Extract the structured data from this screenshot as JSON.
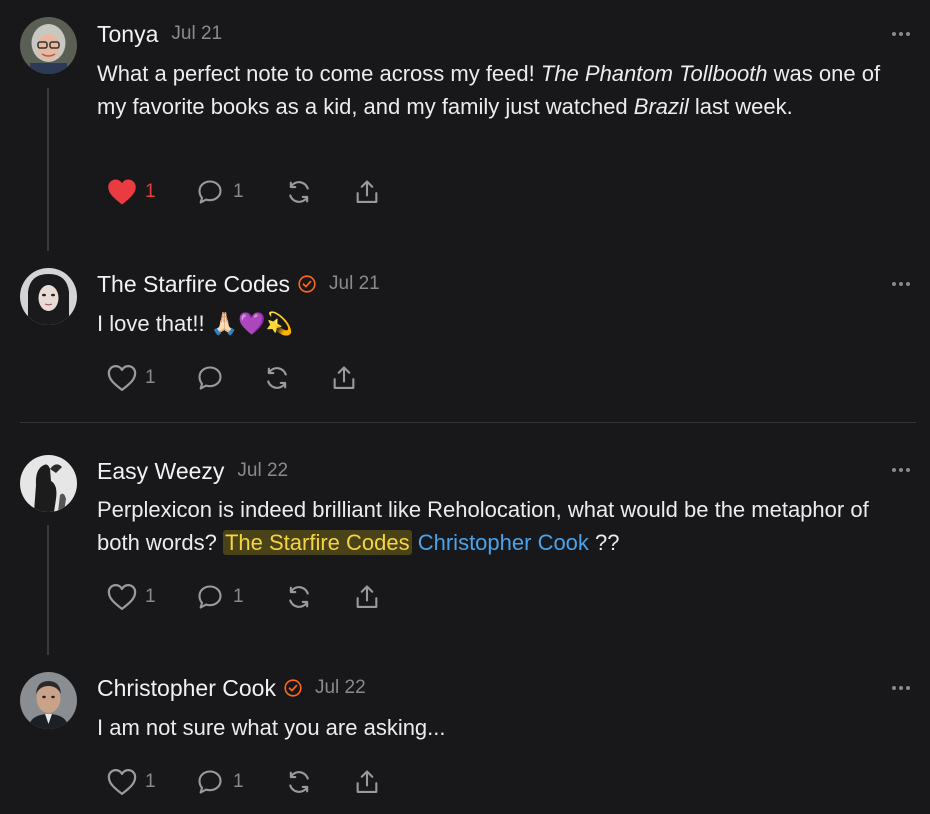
{
  "comments": [
    {
      "author": "Tonya",
      "date": "Jul 21",
      "text_parts": [
        "What a perfect note to come across my feed! ",
        "The Phantom Tollbooth",
        " was one of my favorite books as a kid, and my family just watched ",
        "Brazil",
        " last week."
      ],
      "like_count": "1",
      "liked": true,
      "reply_count": "1"
    },
    {
      "author": "The Starfire Codes",
      "verified": true,
      "date": "Jul 21",
      "text": "I love that!! 🙏🏻💜💫",
      "like_count": "1"
    },
    {
      "author": "Easy Weezy",
      "date": "Jul 22",
      "text_parts": [
        "Perplexicon is indeed brilliant like Reholocation, what would be the metaphor of both words? ",
        "The Starfire Codes",
        " ",
        "Christopher Cook",
        " ??"
      ],
      "like_count": "1",
      "reply_count": "1"
    },
    {
      "author": "Christopher Cook",
      "verified": true,
      "date": "Jul 22",
      "text": "I am not sure what you are asking...",
      "like_count": "1",
      "reply_count": "1"
    }
  ],
  "colors": {
    "background": "#18181a",
    "like_active": "#ea3b42",
    "verified_badge": "#ff6719",
    "mention_highlight_text": "#f5d442",
    "mention_link": "#4aa3ea",
    "muted": "#8a8a8e"
  },
  "icons": [
    "avatar",
    "verified-badge-icon",
    "more-options-icon",
    "heart-icon",
    "comment-icon",
    "restack-icon",
    "share-icon"
  ]
}
